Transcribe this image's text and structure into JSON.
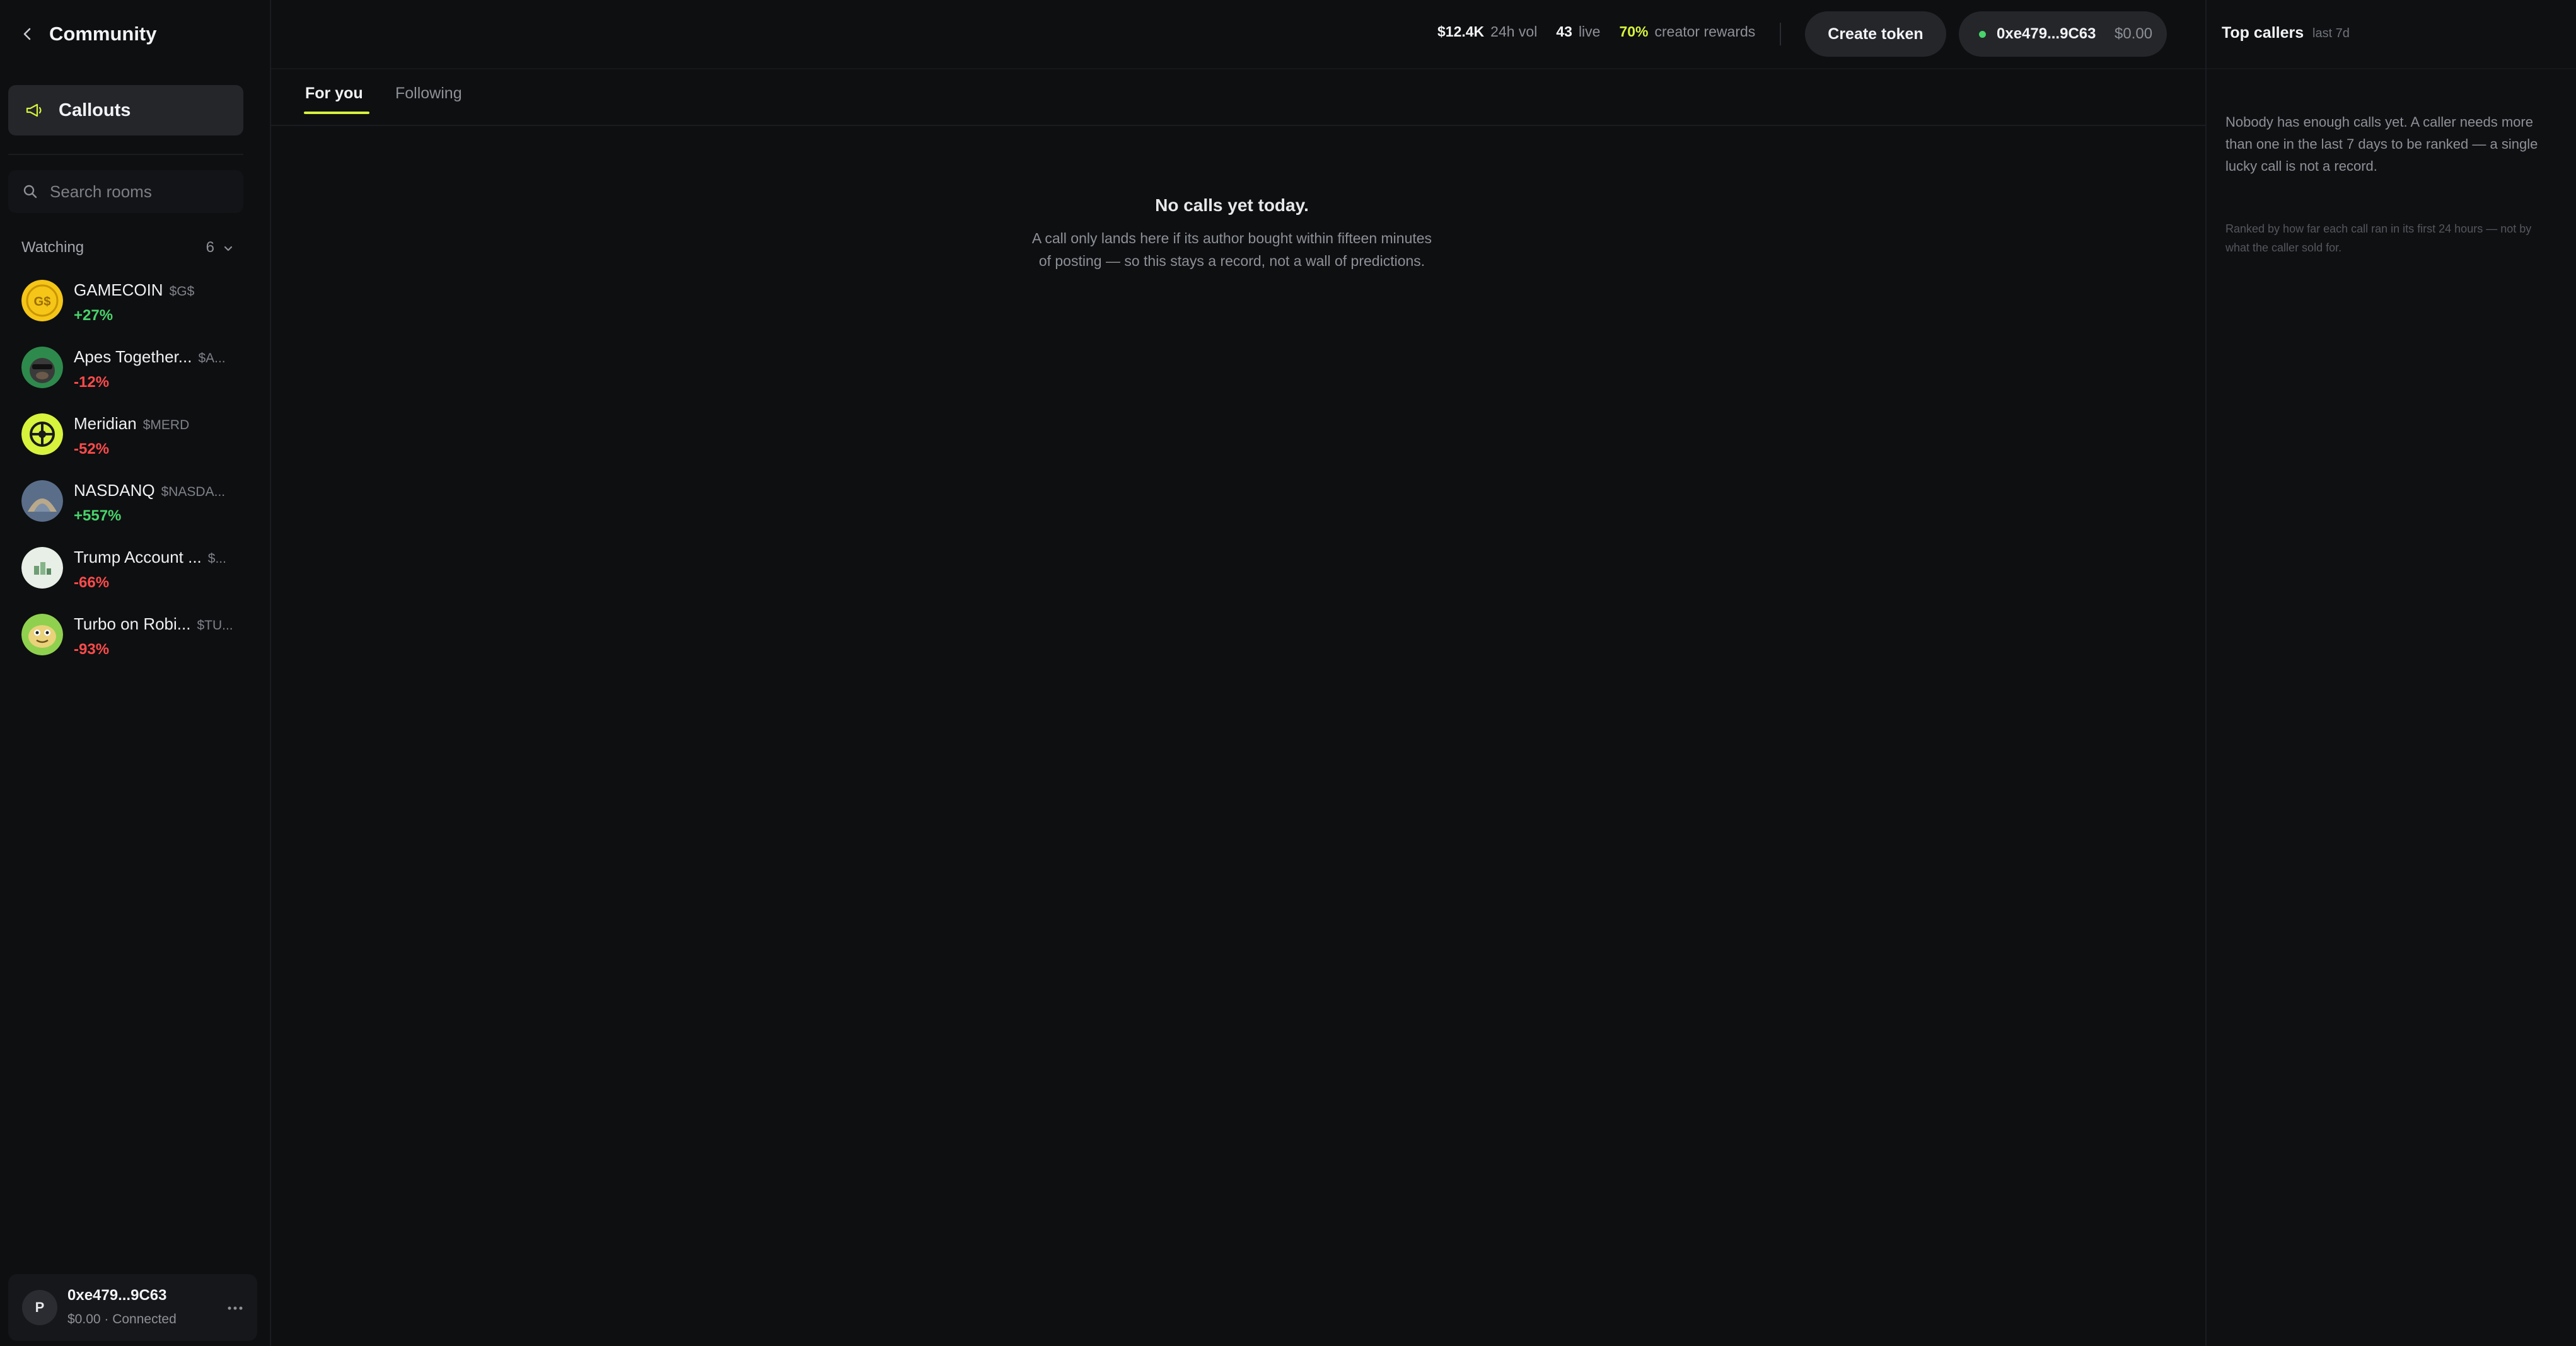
{
  "sidebar": {
    "title": "Community",
    "callouts_label": "Callouts",
    "search_placeholder": "Search rooms",
    "watching": {
      "label": "Watching",
      "count": "6"
    },
    "coins": [
      {
        "name": "GAMECOIN",
        "ticker": "$G$",
        "change": "+27%",
        "direction": "pos",
        "icon": "gamecoin-avatar",
        "color": "#f5c518"
      },
      {
        "name": "Apes Together...",
        "ticker": "$A...",
        "change": "-12%",
        "direction": "neg",
        "icon": "ape-avatar",
        "color": "#2e8a4c"
      },
      {
        "name": "Meridian",
        "ticker": "$MERD",
        "change": "-52%",
        "direction": "neg",
        "icon": "meridian-avatar",
        "color": "#d7f33c"
      },
      {
        "name": "NASDANQ",
        "ticker": "$NASDA...",
        "change": "+557%",
        "direction": "pos",
        "icon": "nasdanq-avatar",
        "color": "#5a6e8a"
      },
      {
        "name": "Trump Account ...",
        "ticker": "$...",
        "change": "-66%",
        "direction": "neg",
        "icon": "trump-account-avatar",
        "color": "#e8efe6"
      },
      {
        "name": "Turbo on Robi...",
        "ticker": "$TU...",
        "change": "-93%",
        "direction": "neg",
        "icon": "turbo-avatar",
        "color": "#8fd14f"
      }
    ],
    "account": {
      "initial": "P",
      "address": "0xe479...9C63",
      "status": "$0.00 · Connected"
    }
  },
  "topbar": {
    "volume_value": "$12.4K",
    "volume_label": "24h vol",
    "live_value": "43",
    "live_label": "live",
    "rewards_value": "70%",
    "rewards_label": "creator rewards",
    "create_token_label": "Create token",
    "wallet_address": "0xe479...9C63",
    "wallet_balance": "$0.00"
  },
  "feed": {
    "tabs": [
      {
        "label": "For you",
        "active": true
      },
      {
        "label": "Following",
        "active": false
      }
    ],
    "empty_title": "No calls yet today.",
    "empty_description": "A call only lands here if its author bought within fifteen minutes of posting — so this stays a record, not a wall of predictions."
  },
  "right_panel": {
    "title": "Top callers",
    "subtitle": "last 7d",
    "message": "Nobody has enough calls yet. A caller needs more than one in the last 7 days to be ranked — a single lucky call is not a record.",
    "note": "Ranked by how far each call ran in its first 24 hours — not by what the caller sold for."
  },
  "colors": {
    "accent": "#d7f33c",
    "positive": "#49d36b",
    "negative": "#ff4b4b",
    "background": "#0e0f11"
  }
}
